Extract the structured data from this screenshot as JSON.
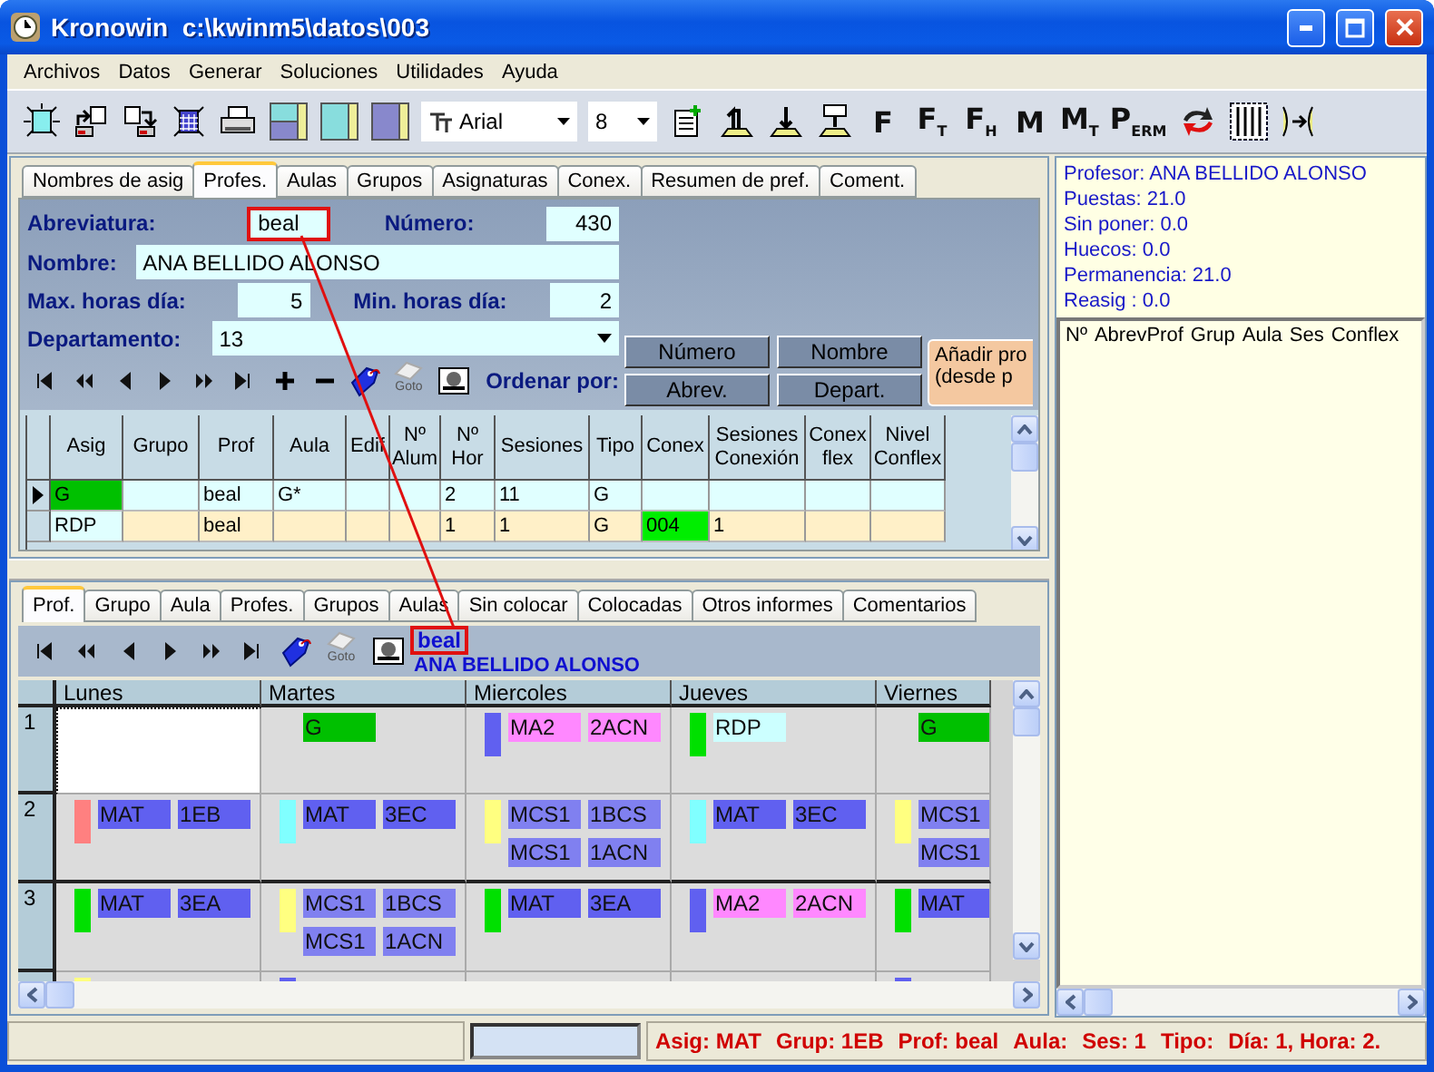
{
  "window": {
    "title": "Kronowin  c:\\kwinm5\\datos\\003"
  },
  "menu": [
    {
      "label": "Archivos"
    },
    {
      "label": "Datos"
    },
    {
      "label": "Generar"
    },
    {
      "label": "Soluciones"
    },
    {
      "label": "Utilidades"
    },
    {
      "label": "Ayuda"
    }
  ],
  "toolbar": {
    "font": "Arial",
    "size": "8",
    "letter_buttons": [
      "F",
      "F$_{T}$",
      "F$_{H}$",
      "M",
      "M$_{T}$",
      "P$_{ERM}$"
    ]
  },
  "upper_tabs": [
    {
      "label": "Nombres de asig",
      "selected": false
    },
    {
      "label": "Profes.",
      "selected": true
    },
    {
      "label": "Aulas",
      "selected": false
    },
    {
      "label": "Grupos",
      "selected": false
    },
    {
      "label": "Asignaturas",
      "selected": false
    },
    {
      "label": "Conex.",
      "selected": false
    },
    {
      "label": "Resumen de pref.",
      "selected": false
    },
    {
      "label": "Coment.",
      "selected": false
    }
  ],
  "form": {
    "abbreviation": {
      "label": "Abreviatura:",
      "value": "beal",
      "highlighted": true
    },
    "number": {
      "label": "Número:",
      "value": "430"
    },
    "name": {
      "label": "Nombre:",
      "value": "ANA BELLIDO ALONSO"
    },
    "max_hours": {
      "label": "Max. horas día:",
      "value": "5"
    },
    "min_hours": {
      "label": "Min. horas día:",
      "value": "2"
    },
    "department": {
      "label": "Departamento:",
      "value": "13"
    },
    "goto_label": "Goto",
    "sort_label": "Ordenar por:",
    "sort_buttons": [
      "Número",
      "Nombre",
      "Abrev.",
      "Depart."
    ],
    "add_button": [
      "Añadir pro",
      "(desde p"
    ]
  },
  "upper_grid": {
    "columns": [
      "Asig",
      "Grupo",
      "Prof",
      "Aula",
      "Edif",
      "Nº Alum",
      "Nº Hor",
      "Sesiones",
      "Tipo",
      "Conex",
      "Sesiones Conexión",
      "Conex flex",
      "Nivel Conflex"
    ],
    "rows": [
      {
        "current": true,
        "color": "#e0ffff",
        "cells": [
          {
            "text": "G",
            "color": "#00c000"
          },
          {},
          {
            "text": "beal"
          },
          {
            "text": "G*"
          },
          {},
          {},
          {
            "text": "2"
          },
          {
            "text": "11"
          },
          {
            "text": "G"
          },
          {},
          {},
          {},
          {}
        ]
      },
      {
        "current": false,
        "color": "#fff0c8",
        "cells": [
          {
            "text": "RDP",
            "color": "#e0ffff"
          },
          {},
          {
            "text": "beal"
          },
          {},
          {},
          {},
          {
            "text": "1"
          },
          {
            "text": "1"
          },
          {
            "text": "G"
          },
          {
            "text": "004",
            "color": "#00ee00"
          },
          {
            "text": "1"
          },
          {},
          {}
        ]
      }
    ]
  },
  "lower_tabs": [
    {
      "label": "Prof.",
      "selected": true
    },
    {
      "label": "Grupo",
      "selected": false
    },
    {
      "label": "Aula",
      "selected": false
    },
    {
      "label": "Profes.",
      "selected": false
    },
    {
      "label": "Grupos",
      "selected": false
    },
    {
      "label": "Aulas",
      "selected": false
    },
    {
      "label": "Sin colocar",
      "selected": false
    },
    {
      "label": "Colocadas",
      "selected": false
    },
    {
      "label": "Otros informes",
      "selected": false
    },
    {
      "label": "Comentarios",
      "selected": false
    }
  ],
  "timetable_bar": {
    "goto_label": "Goto",
    "abbreviation": "beal",
    "highlighted": true,
    "name": "ANA BELLIDO ALONSO"
  },
  "timetable": {
    "days": [
      "Lunes",
      "Martes",
      "Miercoles",
      "Jueves",
      "Viernes"
    ],
    "rows": [
      {
        "hour": "1",
        "cells": [
          {
            "selected": true
          },
          {
            "selected": false,
            "entries": [
              {
                "subject": "G",
                "color": "#00c000"
              }
            ]
          },
          {
            "selected": false,
            "marker": {
              "color": "#6060f0"
            },
            "entries": [
              {
                "subject": "MA2",
                "group": "2ACN",
                "color": "#ff88ff"
              }
            ]
          },
          {
            "selected": false,
            "marker": {
              "color": "#00e000"
            },
            "entries": [
              {
                "subject": "RDP",
                "color": "#ccffff"
              }
            ]
          },
          {
            "selected": false,
            "entries": [
              {
                "subject": "G",
                "color": "#00c000"
              }
            ]
          }
        ]
      },
      {
        "hour": "2",
        "cells": [
          {
            "selected": false,
            "marker": {
              "color": "#ff8080"
            },
            "entries": [
              {
                "subject": "MAT",
                "group": "1EB",
                "color": "#6060f0"
              }
            ]
          },
          {
            "selected": false,
            "marker": {
              "color": "#80ffff"
            },
            "entries": [
              {
                "subject": "MAT",
                "group": "3EC",
                "color": "#6060f0"
              }
            ]
          },
          {
            "selected": false,
            "marker": {
              "color": "#ffff80"
            },
            "entries": [
              {
                "subject": "MCS1",
                "group": "1BCS",
                "color": "#8080f0"
              },
              {
                "subject": "MCS1",
                "group": "1ACN",
                "color": "#8080f0"
              }
            ]
          },
          {
            "selected": false,
            "marker": {
              "color": "#80ffff"
            },
            "entries": [
              {
                "subject": "MAT",
                "group": "3EC",
                "color": "#6060f0"
              }
            ]
          },
          {
            "selected": false,
            "marker": {
              "color": "#ffff80"
            },
            "entries": [
              {
                "subject": "MCS1",
                "color": "#8080f0"
              },
              {
                "subject": "MCS1",
                "color": "#8080f0"
              }
            ]
          }
        ]
      },
      {
        "hour": "3",
        "cells": [
          {
            "selected": false,
            "marker": {
              "color": "#00e000"
            },
            "entries": [
              {
                "subject": "MAT",
                "group": "3EA",
                "color": "#6060f0"
              }
            ]
          },
          {
            "selected": false,
            "marker": {
              "color": "#ffff80"
            },
            "entries": [
              {
                "subject": "MCS1",
                "group": "1BCS",
                "color": "#8080f0"
              },
              {
                "subject": "MCS1",
                "group": "1ACN",
                "color": "#8080f0"
              }
            ]
          },
          {
            "selected": false,
            "marker": {
              "color": "#00e000"
            },
            "entries": [
              {
                "subject": "MAT",
                "group": "3EA",
                "color": "#6060f0"
              }
            ]
          },
          {
            "selected": false,
            "marker": {
              "color": "#6060f0"
            },
            "entries": [
              {
                "subject": "MA2",
                "group": "2ACN",
                "color": "#ff88ff"
              }
            ]
          },
          {
            "selected": false,
            "marker": {
              "color": "#00e000"
            },
            "entries": [
              {
                "subject": "MAT",
                "color": "#6060f0"
              }
            ]
          }
        ]
      },
      {
        "cells": [
          {
            "selected": false,
            "marker": {
              "color": "#ffff80"
            }
          },
          {
            "selected": false,
            "marker": {
              "color": "#6060f0"
            }
          },
          {
            "selected": false
          },
          {
            "selected": false
          },
          {
            "selected": false,
            "marker": {
              "color": "#6060f0"
            }
          }
        ]
      }
    ]
  },
  "info": {
    "lines": [
      "Profesor: ANA BELLIDO ALONSO",
      "Puestas: 21.0",
      "Sin poner: 0.0",
      "Huecos: 0.0",
      "Permanencia: 21.0",
      "Reasig : 0.0"
    ],
    "list_columns": [
      "Nº",
      "AbrevProf",
      "Grup",
      "Aula",
      "Ses",
      "Conflex"
    ]
  },
  "status_bar": {
    "items": [
      "Asig: MAT",
      "Grup: 1EB",
      "Prof: beal",
      "Aula:",
      "Ses: 1",
      "Tipo:",
      "Día: 1, Hora: 2."
    ]
  }
}
